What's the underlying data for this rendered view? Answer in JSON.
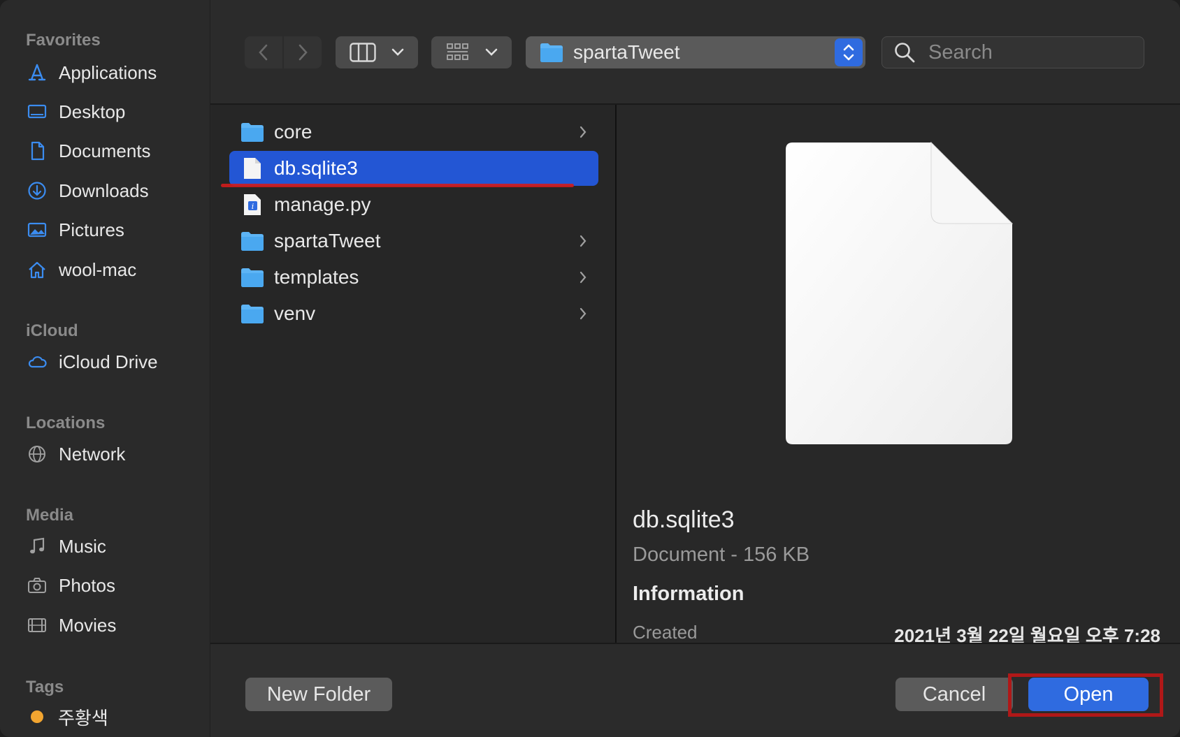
{
  "sidebar": {
    "sections": [
      {
        "title": "Favorites"
      },
      {
        "title": "iCloud"
      },
      {
        "title": "Locations"
      },
      {
        "title": "Media"
      },
      {
        "title": "Tags"
      }
    ],
    "favorites": [
      {
        "label": "Applications",
        "icon": "applications-icon"
      },
      {
        "label": "Desktop",
        "icon": "desktop-icon"
      },
      {
        "label": "Documents",
        "icon": "document-icon"
      },
      {
        "label": "Downloads",
        "icon": "download-icon"
      },
      {
        "label": "Pictures",
        "icon": "pictures-icon"
      },
      {
        "label": "wool-mac",
        "icon": "home-icon"
      }
    ],
    "icloud": [
      {
        "label": "iCloud Drive",
        "icon": "cloud-icon"
      }
    ],
    "locations": [
      {
        "label": "Network",
        "icon": "globe-icon"
      }
    ],
    "media": [
      {
        "label": "Music",
        "icon": "music-note-icon"
      },
      {
        "label": "Photos",
        "icon": "camera-icon"
      },
      {
        "label": "Movies",
        "icon": "film-icon"
      }
    ],
    "tags": [
      {
        "label": "주황색",
        "color": "#f2a530"
      }
    ]
  },
  "toolbar": {
    "path_label": "spartaTweet",
    "search_placeholder": "Search"
  },
  "files": [
    {
      "name": "core",
      "kind": "folder"
    },
    {
      "name": "db.sqlite3",
      "kind": "document",
      "selected": true
    },
    {
      "name": "manage.py",
      "kind": "python"
    },
    {
      "name": "spartaTweet",
      "kind": "folder"
    },
    {
      "name": "templates",
      "kind": "folder"
    },
    {
      "name": "venv",
      "kind": "folder"
    }
  ],
  "preview": {
    "name": "db.sqlite3",
    "kind": "Document - 156 KB",
    "info_heading": "Information",
    "created_label": "Created",
    "created_value": "2021년 3월 22일 월요일 오후 7:28"
  },
  "buttons": {
    "new_folder": "New Folder",
    "cancel": "Cancel",
    "open": "Open"
  },
  "colors": {
    "accent": "#2f6be0",
    "selection": "#2356d4",
    "annotation_red": "#b01818",
    "folder_blue": "#4aa8f0"
  }
}
